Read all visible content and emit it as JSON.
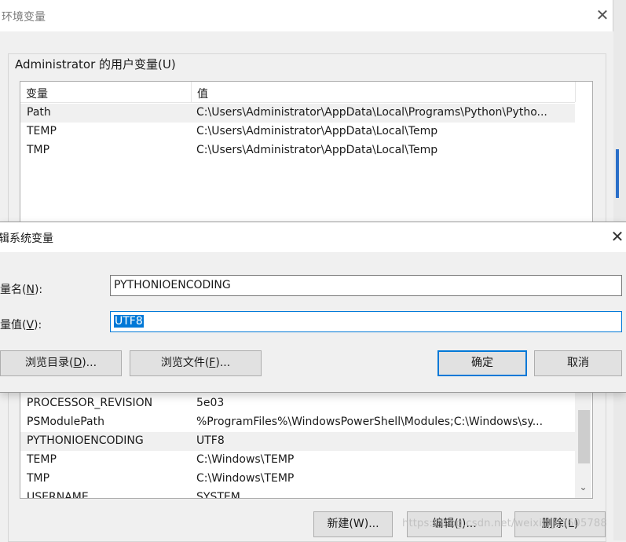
{
  "background_window": {
    "title": "环境变量",
    "close_glyph": "✕",
    "user_vars_group_label": "Administrator 的用户变量(U)",
    "user_vars": {
      "columns": [
        "变量",
        "值"
      ],
      "rows": [
        {
          "name": "Path",
          "value": "C:\\Users\\Administrator\\AppData\\Local\\Programs\\Python\\Pytho..."
        },
        {
          "name": "TEMP",
          "value": "C:\\Users\\Administrator\\AppData\\Local\\Temp"
        },
        {
          "name": "TMP",
          "value": "C:\\Users\\Administrator\\AppData\\Local\\Temp"
        }
      ]
    },
    "system_vars": {
      "rows": [
        {
          "name": "PROCESSOR_REVISION",
          "value": "5e03"
        },
        {
          "name": "PSModulePath",
          "value": "%ProgramFiles%\\WindowsPowerShell\\Modules;C:\\Windows\\sy..."
        },
        {
          "name": "PYTHONIOENCODING",
          "value": "UTF8"
        },
        {
          "name": "TEMP",
          "value": "C:\\Windows\\TEMP"
        },
        {
          "name": "TMP",
          "value": "C:\\Windows\\TEMP"
        },
        {
          "name": "USERNAME",
          "value": "SYSTEM"
        }
      ]
    },
    "buttons": {
      "new": "新建(W)...",
      "edit": "编辑(I)...",
      "delete": "删除(L)"
    },
    "watermark": "https://blog.csdn.net/weixin_43605788"
  },
  "edit_dialog": {
    "title": "辑系统变量",
    "close_glyph": "✕",
    "name_label_pre": "量名(",
    "name_label_key": "N",
    "name_label_post": "):",
    "value_label_pre": "量值(",
    "value_label_key": "V",
    "value_label_post": "):",
    "name_value": "PYTHONIOENCODING",
    "value_value": "UTF8",
    "browse_dir_pre": "浏览目录(",
    "browse_dir_key": "D",
    "browse_dir_post": ")...",
    "browse_file_pre": "浏览文件(",
    "browse_file_key": "F",
    "browse_file_post": ")...",
    "ok": "确定",
    "cancel": "取消"
  },
  "colors": {
    "accent": "#0078d7",
    "selected_row": "#f0f0f0"
  }
}
